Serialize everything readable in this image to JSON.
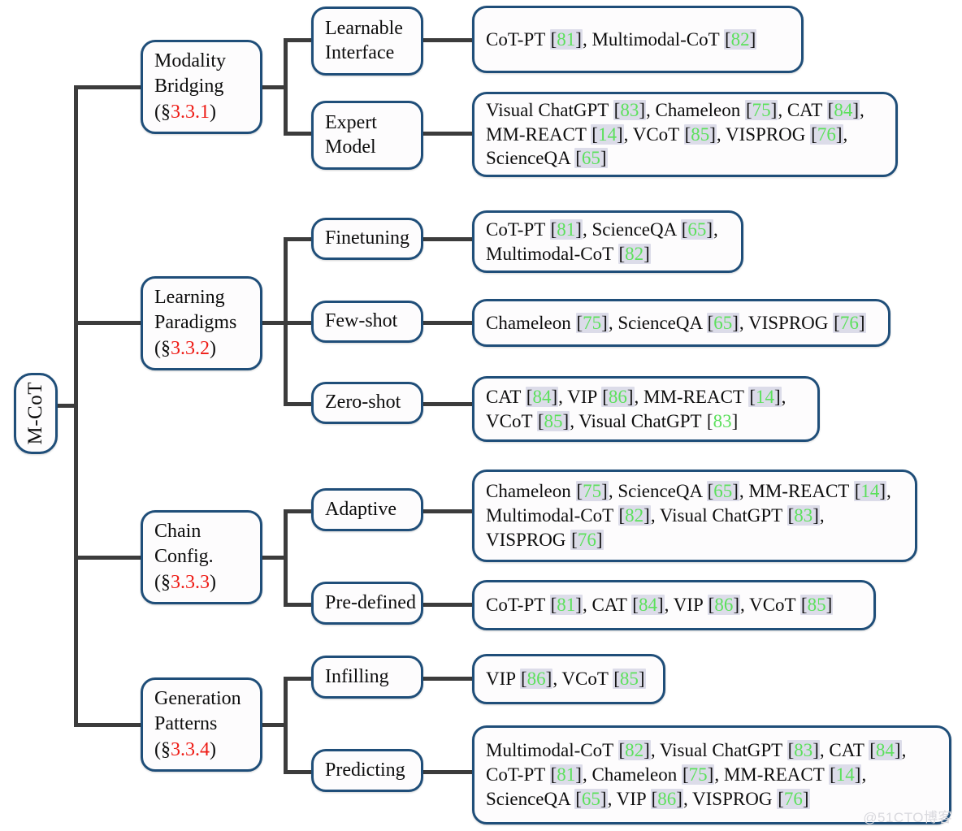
{
  "diagram": {
    "title": "M-CoT taxonomy",
    "colors": {
      "node_border": "#1f4e79",
      "node_fill": "#fdfcfd",
      "connector": "#3c3c3c",
      "section_number": "#ee1c16",
      "citation_number": "#5ce05c",
      "citation_highlight": "#dcdce9",
      "page_background": "#ffffff"
    },
    "watermark": "@51CTO博客"
  },
  "root": {
    "label": "M-CoT"
  },
  "categories": [
    {
      "name": "Modality Bridging",
      "line1": "Modality",
      "line2": "Bridging",
      "section_prefix": "(§",
      "section": "3.3.1",
      "section_suffix": ")"
    },
    {
      "name": "Learning Paradigms",
      "line1": "Learning",
      "line2": "Paradigms",
      "section_prefix": "(§",
      "section": "3.3.2",
      "section_suffix": ")"
    },
    {
      "name": "Chain Config.",
      "line1": "Chain",
      "line2": "Config.",
      "section_prefix": "(§",
      "section": "3.3.3",
      "section_suffix": ")"
    },
    {
      "name": "Generation Patterns",
      "line1": "Generation",
      "line2": "Patterns",
      "section_prefix": "(§",
      "section": "3.3.4",
      "section_suffix": ")"
    }
  ],
  "subcategories": [
    {
      "id": "learnable-interface",
      "line1": "Learnable",
      "line2": "Interface"
    },
    {
      "id": "expert-model",
      "line1": "Expert",
      "line2": "Model"
    },
    {
      "id": "finetuning",
      "line1": "Finetuning",
      "line2": ""
    },
    {
      "id": "few-shot",
      "line1": "Few-shot",
      "line2": ""
    },
    {
      "id": "zero-shot",
      "line1": "Zero-shot",
      "line2": ""
    },
    {
      "id": "adaptive",
      "line1": "Adaptive",
      "line2": ""
    },
    {
      "id": "pre-defined",
      "line1": "Pre-defined",
      "line2": ""
    },
    {
      "id": "infilling",
      "line1": "Infilling",
      "line2": ""
    },
    {
      "id": "predicting",
      "line1": "Predicting",
      "line2": ""
    }
  ],
  "leaves": [
    {
      "id": "leaf-learnable-interface",
      "lines": [
        [
          {
            "t": "CoT-PT "
          },
          {
            "c": "81"
          },
          {
            "t": ", Multimodal-CoT "
          },
          {
            "c": "82"
          }
        ]
      ]
    },
    {
      "id": "leaf-expert-model",
      "lines": [
        [
          {
            "t": "Visual ChatGPT "
          },
          {
            "c": "83"
          },
          {
            "t": ", Chameleon "
          },
          {
            "c": "75"
          },
          {
            "t": ", CAT "
          },
          {
            "c": "84"
          },
          {
            "t": ","
          }
        ],
        [
          {
            "t": "MM-REACT "
          },
          {
            "c": "14"
          },
          {
            "t": ", VCoT "
          },
          {
            "c": "85"
          },
          {
            "t": ", VISPROG "
          },
          {
            "c": "76"
          },
          {
            "t": ","
          }
        ],
        [
          {
            "t": "ScienceQA "
          },
          {
            "c": "65"
          }
        ]
      ]
    },
    {
      "id": "leaf-finetuning",
      "lines": [
        [
          {
            "t": "CoT-PT "
          },
          {
            "c": "81"
          },
          {
            "t": ", ScienceQA "
          },
          {
            "c": "65"
          },
          {
            "t": ","
          }
        ],
        [
          {
            "t": "Multimodal-CoT "
          },
          {
            "c": "82"
          }
        ]
      ]
    },
    {
      "id": "leaf-few-shot",
      "lines": [
        [
          {
            "t": "Chameleon "
          },
          {
            "c": "75"
          },
          {
            "t": ", ScienceQA "
          },
          {
            "c": "65"
          },
          {
            "t": ", VISPROG "
          },
          {
            "c": "76"
          }
        ]
      ]
    },
    {
      "id": "leaf-zero-shot",
      "lines": [
        [
          {
            "t": "CAT "
          },
          {
            "c": "84"
          },
          {
            "t": ", VIP "
          },
          {
            "c": "86"
          },
          {
            "t": ", MM-REACT "
          },
          {
            "c": "14"
          },
          {
            "t": ","
          }
        ],
        [
          {
            "t": "VCoT "
          },
          {
            "c": "85"
          },
          {
            "t": ", Visual ChatGPT "
          },
          {
            "c": "83",
            "hl": false
          }
        ]
      ]
    },
    {
      "id": "leaf-adaptive",
      "lines": [
        [
          {
            "t": "Chameleon "
          },
          {
            "c": "75"
          },
          {
            "t": ", ScienceQA "
          },
          {
            "c": "65"
          },
          {
            "t": ", MM-REACT "
          },
          {
            "c": "14"
          },
          {
            "t": ","
          }
        ],
        [
          {
            "t": "Multimodal-CoT "
          },
          {
            "c": "82"
          },
          {
            "t": ", Visual ChatGPT "
          },
          {
            "c": "83"
          },
          {
            "t": ","
          }
        ],
        [
          {
            "t": "VISPROG "
          },
          {
            "c": "76"
          }
        ]
      ]
    },
    {
      "id": "leaf-pre-defined",
      "lines": [
        [
          {
            "t": "CoT-PT "
          },
          {
            "c": "81"
          },
          {
            "t": ", CAT "
          },
          {
            "c": "84"
          },
          {
            "t": ", VIP "
          },
          {
            "c": "86"
          },
          {
            "t": ", VCoT "
          },
          {
            "c": "85"
          }
        ]
      ]
    },
    {
      "id": "leaf-infilling",
      "lines": [
        [
          {
            "t": "VIP "
          },
          {
            "c": "86"
          },
          {
            "t": ", VCoT "
          },
          {
            "c": "85"
          }
        ]
      ]
    },
    {
      "id": "leaf-predicting",
      "lines": [
        [
          {
            "t": "Multimodal-CoT "
          },
          {
            "c": "82"
          },
          {
            "t": ", Visual ChatGPT "
          },
          {
            "c": "83"
          },
          {
            "t": ", CAT "
          },
          {
            "c": "84"
          },
          {
            "t": ","
          }
        ],
        [
          {
            "t": "CoT-PT "
          },
          {
            "c": "81"
          },
          {
            "t": ", Chameleon "
          },
          {
            "c": "75"
          },
          {
            "t": ", MM-REACT "
          },
          {
            "c": "14"
          },
          {
            "t": ","
          }
        ],
        [
          {
            "t": "ScienceQA "
          },
          {
            "c": "65"
          },
          {
            "t": ", VIP "
          },
          {
            "c": "86"
          },
          {
            "t": ",  VISPROG "
          },
          {
            "c": "76"
          }
        ]
      ]
    }
  ]
}
